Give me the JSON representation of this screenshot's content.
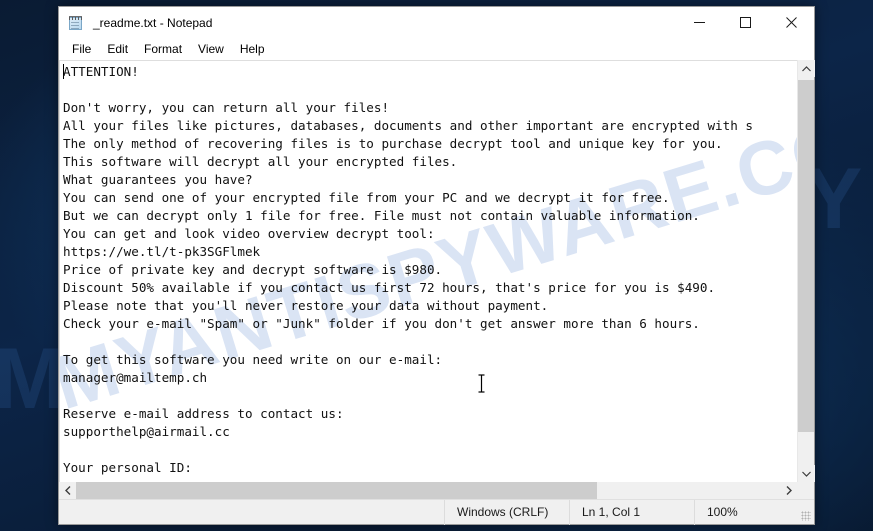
{
  "desktop": {
    "background_color": "#0c2548",
    "watermark_fragments": [
      "M",
      "Y"
    ]
  },
  "window": {
    "title": "_readme.txt - Notepad",
    "icon": "notepad-icon",
    "controls": {
      "minimize_label": "Minimize",
      "maximize_label": "Maximize",
      "close_label": "Close"
    }
  },
  "menu": {
    "items": [
      {
        "label": "File"
      },
      {
        "label": "Edit"
      },
      {
        "label": "Format"
      },
      {
        "label": "View"
      },
      {
        "label": "Help"
      }
    ]
  },
  "editor": {
    "watermark": "MYANTISPYWARE.COM",
    "text": "ATTENTION!\n\nDon't worry, you can return all your files!\nAll your files like pictures, databases, documents and other important are encrypted with s\nThe only method of recovering files is to purchase decrypt tool and unique key for you.\nThis software will decrypt all your encrypted files.\nWhat guarantees you have?\nYou can send one of your encrypted file from your PC and we decrypt it for free.\nBut we can decrypt only 1 file for free. File must not contain valuable information.\nYou can get and look video overview decrypt tool:\nhttps://we.tl/t-pk3SGFlmek\nPrice of private key and decrypt software is $980.\nDiscount 50% available if you contact us first 72 hours, that's price for you is $490.\nPlease note that you'll never restore your data without payment.\nCheck your e-mail \"Spam\" or \"Junk\" folder if you don't get answer more than 6 hours.\n\nTo get this software you need write on our e-mail:\nmanager@mailtemp.ch\n\nReserve e-mail address to contact us:\nsupporthelp@airmail.cc\n\nYour personal ID:",
    "details": {
      "download_url": "https://we.tl/t-pk3SGFlmek",
      "price_full": "$980",
      "price_discount": "$490",
      "discount_percent": "50%",
      "discount_window": "72 hours",
      "answer_window": "6 hours",
      "primary_email": "manager@mailtemp.ch",
      "reserve_email": "supporthelp@airmail.cc",
      "free_files": "1 file"
    }
  },
  "scrollbars": {
    "vertical_up": "▲",
    "vertical_down": "▼",
    "horizontal_left": "◀",
    "horizontal_right": "▶"
  },
  "status_bar": {
    "line_ending": "Windows (CRLF)",
    "cursor_position": "Ln 1, Col 1",
    "zoom": "100%"
  }
}
